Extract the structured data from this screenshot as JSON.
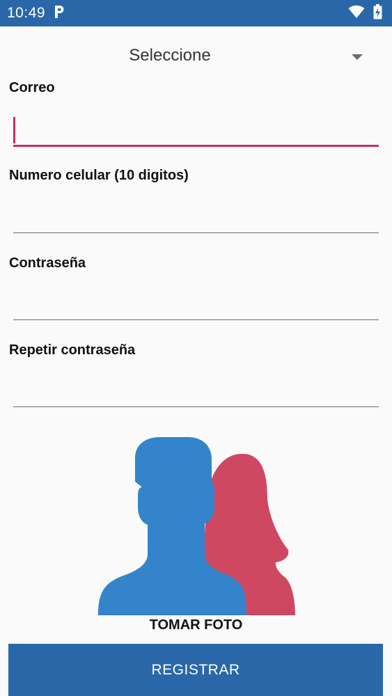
{
  "status_bar": {
    "time": "10:49",
    "notification_icon": "parking-p-icon",
    "wifi_icon": "wifi-icon",
    "battery_icon": "battery-charging-icon"
  },
  "form": {
    "spinner": {
      "selected": "Seleccione",
      "icon": "dropdown-arrow-icon"
    },
    "fields": [
      {
        "label": "Correo",
        "value": ""
      },
      {
        "label": "Numero celular (10 digitos)",
        "value": ""
      },
      {
        "label": "Contraseña",
        "value": ""
      },
      {
        "label": "Repetir contraseña",
        "value": ""
      }
    ],
    "photo": {
      "label": "TOMAR FOTO",
      "icon": "people-avatar-icon"
    },
    "register_label": "REGISTRAR"
  },
  "colors": {
    "primary": "#2a67a8",
    "accent": "#c8305c",
    "avatar_male": "#3384cb",
    "avatar_female": "#ce4862"
  }
}
